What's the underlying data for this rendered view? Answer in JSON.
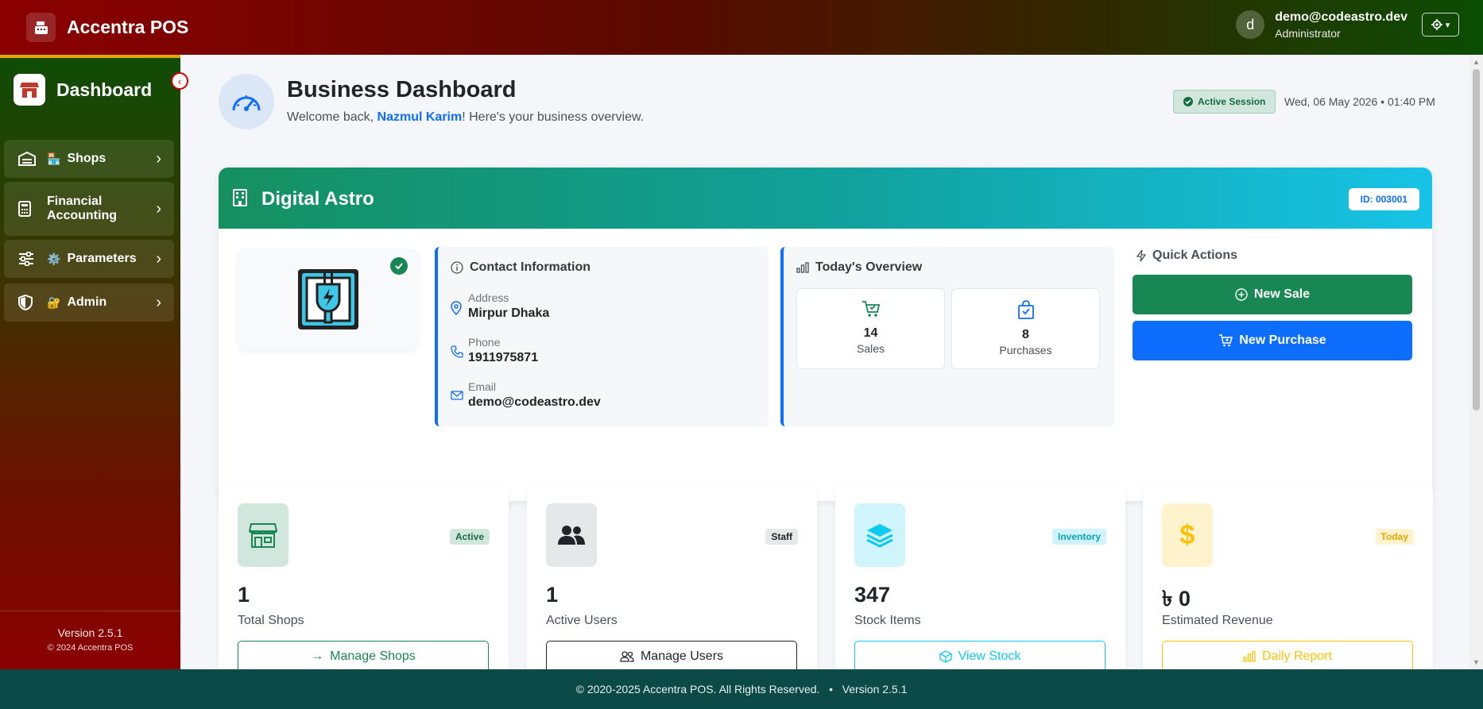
{
  "app": {
    "brand": "Accentra POS",
    "user_email": "demo@codeastro.dev",
    "user_role": "Administrator",
    "avatar_initial": "d"
  },
  "sidebar": {
    "title": "Dashboard",
    "items": [
      {
        "emoji": "🏪",
        "label": "Shops"
      },
      {
        "emoji": "",
        "label": "Financial Accounting"
      },
      {
        "emoji": "⚙️",
        "label": "Parameters"
      },
      {
        "emoji": "🔐",
        "label": "Admin"
      }
    ],
    "version": "Version 2.5.1",
    "copyright": "© 2024 Accentra POS"
  },
  "header": {
    "title": "Business Dashboard",
    "welcome_prefix": "Welcome back, ",
    "user_name": "Nazmul Karim",
    "welcome_suffix": "! Here's your business overview.",
    "session_badge": "Active Session",
    "datetime": "Wed, 06 May 2026 • 01:40 PM"
  },
  "business": {
    "name": "Digital Astro",
    "id_label": "ID: 003001",
    "contact_title": "Contact Information",
    "address_label": "Address",
    "address": "Mirpur Dhaka",
    "phone_label": "Phone",
    "phone": "1911975871",
    "email_label": "Email",
    "email": "demo@codeastro.dev",
    "overview_title": "Today's Overview",
    "sales_count": "14",
    "sales_label": "Sales",
    "purchases_count": "8",
    "purchases_label": "Purchases",
    "quick_actions_title": "Quick Actions",
    "new_sale": "New Sale",
    "new_purchase": "New Purchase"
  },
  "stats": [
    {
      "badge": "Active",
      "value": "1",
      "label": "Total Shops",
      "button": "Manage Shops"
    },
    {
      "badge": "Staff",
      "value": "1",
      "label": "Active Users",
      "button": "Manage Users"
    },
    {
      "badge": "Inventory",
      "value": "347",
      "label": "Stock Items",
      "button": "View Stock"
    },
    {
      "badge": "Today",
      "value": "৳ 0",
      "label": "Estimated Revenue",
      "button": "Daily Report"
    }
  ],
  "footer": {
    "text": "© 2020-2025 Accentra POS. All Rights Reserved.   •   Version 2.5.1"
  },
  "colors": {
    "primary": "#0d6efd",
    "success": "#198754",
    "info": "#0dcaf0",
    "warning": "#ffc107",
    "footer_bg": "#0b4a47"
  }
}
